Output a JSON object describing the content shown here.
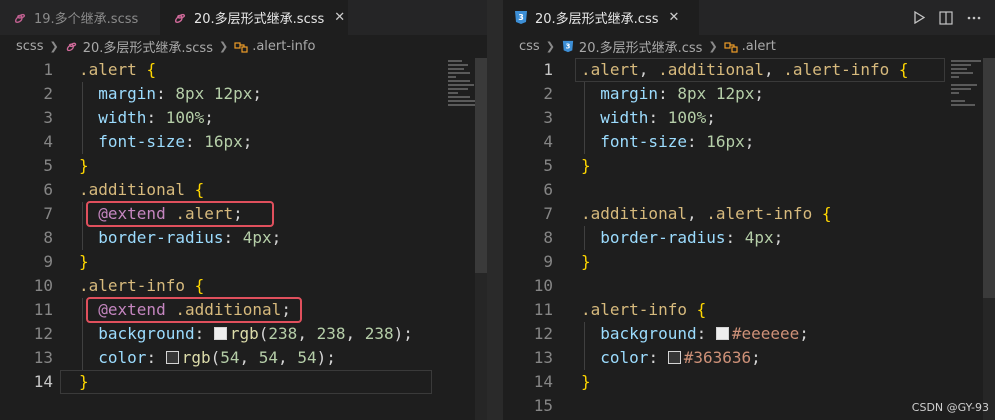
{
  "left_editor": {
    "tabs": [
      {
        "label": "19.多个继承.scss",
        "active": false
      },
      {
        "label": "20.多层形式继承.scss",
        "active": true
      }
    ],
    "breadcrumb": [
      "scss",
      "20.多层形式继承.scss",
      ".alert-info"
    ],
    "current_line": 14,
    "lines": [
      {
        "n": "1",
        "tokens": [
          {
            "t": ".alert",
            "c": "sel"
          },
          {
            "t": " "
          },
          {
            "t": "{",
            "c": "brace"
          }
        ]
      },
      {
        "n": "2",
        "tokens": [
          {
            "t": "  "
          },
          {
            "t": "margin",
            "c": "prop"
          },
          {
            "t": ": ",
            "c": "p"
          },
          {
            "t": "8px 12px",
            "c": "num"
          },
          {
            "t": ";",
            "c": "p"
          }
        ]
      },
      {
        "n": "3",
        "tokens": [
          {
            "t": "  "
          },
          {
            "t": "width",
            "c": "prop"
          },
          {
            "t": ": ",
            "c": "p"
          },
          {
            "t": "100%",
            "c": "num"
          },
          {
            "t": ";",
            "c": "p"
          }
        ]
      },
      {
        "n": "4",
        "tokens": [
          {
            "t": "  "
          },
          {
            "t": "font-size",
            "c": "prop"
          },
          {
            "t": ": ",
            "c": "p"
          },
          {
            "t": "16px",
            "c": "num"
          },
          {
            "t": ";",
            "c": "p"
          }
        ]
      },
      {
        "n": "5",
        "tokens": [
          {
            "t": "}",
            "c": "brace"
          }
        ]
      },
      {
        "n": "6",
        "tokens": [
          {
            "t": ".additional",
            "c": "sel"
          },
          {
            "t": " "
          },
          {
            "t": "{",
            "c": "brace"
          }
        ]
      },
      {
        "n": "7",
        "tokens": [
          {
            "t": "  "
          },
          {
            "t": "@extend",
            "c": "kw"
          },
          {
            "t": " "
          },
          {
            "t": ".alert",
            "c": "sel"
          },
          {
            "t": ";",
            "c": "p"
          }
        ]
      },
      {
        "n": "8",
        "tokens": [
          {
            "t": "  "
          },
          {
            "t": "border-radius",
            "c": "prop"
          },
          {
            "t": ": ",
            "c": "p"
          },
          {
            "t": "4px",
            "c": "num"
          },
          {
            "t": ";",
            "c": "p"
          }
        ]
      },
      {
        "n": "9",
        "tokens": [
          {
            "t": "}",
            "c": "brace"
          }
        ]
      },
      {
        "n": "10",
        "tokens": [
          {
            "t": ".alert-info",
            "c": "sel"
          },
          {
            "t": " "
          },
          {
            "t": "{",
            "c": "brace"
          }
        ]
      },
      {
        "n": "11",
        "tokens": [
          {
            "t": "  "
          },
          {
            "t": "@extend",
            "c": "kw"
          },
          {
            "t": " "
          },
          {
            "t": ".additional",
            "c": "sel"
          },
          {
            "t": ";",
            "c": "p"
          }
        ]
      },
      {
        "n": "12",
        "tokens": [
          {
            "t": "  "
          },
          {
            "t": "background",
            "c": "prop"
          },
          {
            "t": ": ",
            "c": "p"
          },
          {
            "swatch": "#eeeeee"
          },
          {
            "t": "rgb",
            "c": "fn"
          },
          {
            "t": "(",
            "c": "p"
          },
          {
            "t": "238",
            "c": "num"
          },
          {
            "t": ", ",
            "c": "p"
          },
          {
            "t": "238",
            "c": "num"
          },
          {
            "t": ", ",
            "c": "p"
          },
          {
            "t": "238",
            "c": "num"
          },
          {
            "t": ");",
            "c": "p"
          }
        ]
      },
      {
        "n": "13",
        "tokens": [
          {
            "t": "  "
          },
          {
            "t": "color",
            "c": "prop"
          },
          {
            "t": ": ",
            "c": "p"
          },
          {
            "swatch": "#363636"
          },
          {
            "t": "rgb",
            "c": "fn"
          },
          {
            "t": "(",
            "c": "p"
          },
          {
            "t": "54",
            "c": "num"
          },
          {
            "t": ", ",
            "c": "p"
          },
          {
            "t": "54",
            "c": "num"
          },
          {
            "t": ", ",
            "c": "p"
          },
          {
            "t": "54",
            "c": "num"
          },
          {
            "t": ");",
            "c": "p"
          }
        ]
      },
      {
        "n": "14",
        "tokens": [
          {
            "t": "}",
            "c": "brace"
          }
        ]
      }
    ]
  },
  "right_editor": {
    "tabs": [
      {
        "label": "20.多层形式继承.css",
        "active": true
      }
    ],
    "breadcrumb": [
      "css",
      "20.多层形式继承.css",
      ".alert"
    ],
    "current_line": 1,
    "lines": [
      {
        "n": "1",
        "tokens": [
          {
            "t": ".alert",
            "c": "sel"
          },
          {
            "t": ", ",
            "c": "p"
          },
          {
            "t": ".additional",
            "c": "sel"
          },
          {
            "t": ", ",
            "c": "p"
          },
          {
            "t": ".alert-info",
            "c": "sel"
          },
          {
            "t": " "
          },
          {
            "t": "{",
            "c": "brace"
          }
        ]
      },
      {
        "n": "2",
        "tokens": [
          {
            "t": "  "
          },
          {
            "t": "margin",
            "c": "prop"
          },
          {
            "t": ": ",
            "c": "p"
          },
          {
            "t": "8px 12px",
            "c": "num"
          },
          {
            "t": ";",
            "c": "p"
          }
        ]
      },
      {
        "n": "3",
        "tokens": [
          {
            "t": "  "
          },
          {
            "t": "width",
            "c": "prop"
          },
          {
            "t": ": ",
            "c": "p"
          },
          {
            "t": "100%",
            "c": "num"
          },
          {
            "t": ";",
            "c": "p"
          }
        ]
      },
      {
        "n": "4",
        "tokens": [
          {
            "t": "  "
          },
          {
            "t": "font-size",
            "c": "prop"
          },
          {
            "t": ": ",
            "c": "p"
          },
          {
            "t": "16px",
            "c": "num"
          },
          {
            "t": ";",
            "c": "p"
          }
        ]
      },
      {
        "n": "5",
        "tokens": [
          {
            "t": "}",
            "c": "brace"
          }
        ]
      },
      {
        "n": "6",
        "tokens": []
      },
      {
        "n": "7",
        "tokens": [
          {
            "t": ".additional",
            "c": "sel"
          },
          {
            "t": ", ",
            "c": "p"
          },
          {
            "t": ".alert-info",
            "c": "sel"
          },
          {
            "t": " "
          },
          {
            "t": "{",
            "c": "brace"
          }
        ]
      },
      {
        "n": "8",
        "tokens": [
          {
            "t": "  "
          },
          {
            "t": "border-radius",
            "c": "prop"
          },
          {
            "t": ": ",
            "c": "p"
          },
          {
            "t": "4px",
            "c": "num"
          },
          {
            "t": ";",
            "c": "p"
          }
        ]
      },
      {
        "n": "9",
        "tokens": [
          {
            "t": "}",
            "c": "brace"
          }
        ]
      },
      {
        "n": "10",
        "tokens": []
      },
      {
        "n": "11",
        "tokens": [
          {
            "t": ".alert-info",
            "c": "sel"
          },
          {
            "t": " "
          },
          {
            "t": "{",
            "c": "brace"
          }
        ]
      },
      {
        "n": "12",
        "tokens": [
          {
            "t": "  "
          },
          {
            "t": "background",
            "c": "prop"
          },
          {
            "t": ": ",
            "c": "p"
          },
          {
            "swatch": "#eeeeee"
          },
          {
            "t": "#eeeeee",
            "c": "val"
          },
          {
            "t": ";",
            "c": "p"
          }
        ]
      },
      {
        "n": "13",
        "tokens": [
          {
            "t": "  "
          },
          {
            "t": "color",
            "c": "prop"
          },
          {
            "t": ": ",
            "c": "p"
          },
          {
            "swatch": "#363636"
          },
          {
            "t": "#363636",
            "c": "val"
          },
          {
            "t": ";",
            "c": "p"
          }
        ]
      },
      {
        "n": "14",
        "tokens": [
          {
            "t": "}",
            "c": "brace"
          }
        ]
      },
      {
        "n": "15",
        "tokens": []
      }
    ]
  },
  "icons": {
    "scss_file": "sass-icon",
    "css_file": "css3-icon",
    "symbol": "symbol-class-icon",
    "run": "play-icon",
    "split": "split-editor-icon",
    "more": "more-icon"
  },
  "watermark": "CSDN @GY-93"
}
